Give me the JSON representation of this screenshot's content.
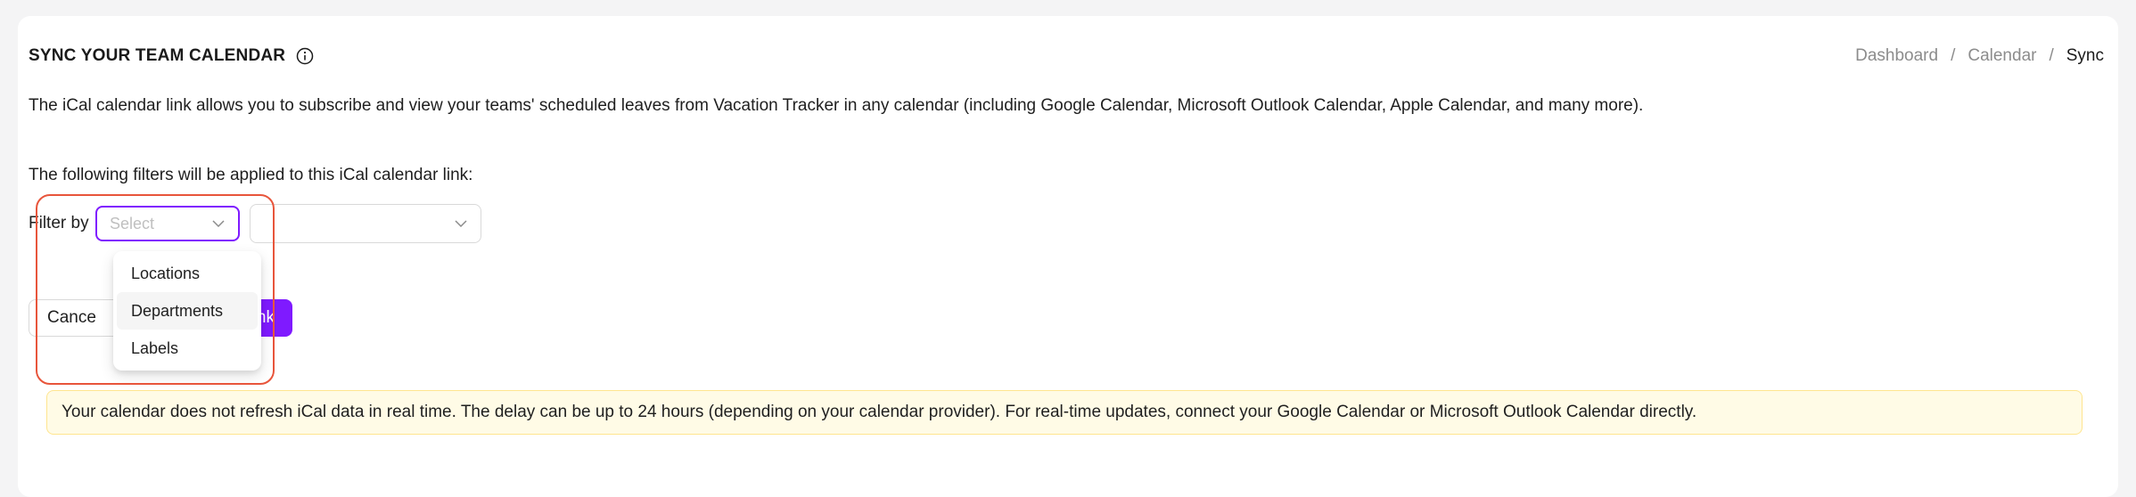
{
  "header": {
    "title": "SYNC YOUR TEAM CALENDAR",
    "info_icon": "info-circle-icon"
  },
  "breadcrumb": {
    "items": [
      "Dashboard",
      "Calendar",
      "Sync"
    ],
    "separator": "/"
  },
  "description": "The iCal calendar link allows you to subscribe and view your teams' scheduled leaves from Vacation Tracker in any calendar (including Google Calendar, Microsoft Outlook Calendar, Apple Calendar, and many more).",
  "filters": {
    "intro": "The following filters will be applied to this iCal calendar link:",
    "filter_by_label": "Filter by",
    "select_placeholder": "Select",
    "dropdown_options": [
      "Locations",
      "Departments",
      "Labels"
    ],
    "hovered_option": "Departments"
  },
  "buttons": {
    "cancel_label": "Cance",
    "primary_label": "nk"
  },
  "notice": "Your calendar does not refresh iCal data in real time. The delay can be up to 24 hours (depending on your calendar provider). For real-time updates, connect your Google Calendar or Microsoft Outlook Calendar directly.",
  "colors": {
    "accent": "#7f1aff",
    "highlight": "#e8553b",
    "notice_bg": "#fffbe6",
    "notice_border": "#ffe58f"
  }
}
